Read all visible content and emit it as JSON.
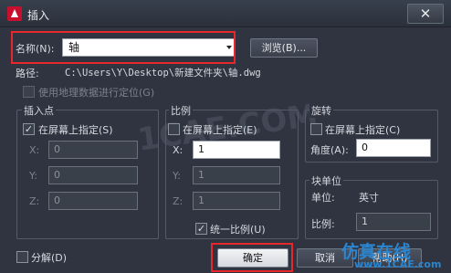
{
  "window": {
    "title": "插入",
    "close": "✕"
  },
  "name": {
    "label": "名称(N):",
    "value": "轴",
    "browse_label": "浏览(B)..."
  },
  "path": {
    "label": "路径:",
    "value": "C:\\Users\\Y\\Desktop\\新建文件夹\\轴.dwg"
  },
  "geo": {
    "label": "使用地理数据进行定位(G)"
  },
  "insertion_point": {
    "title": "插入点",
    "onscreen_label": "在屏幕上指定(S)",
    "onscreen_checked": true,
    "x_label": "X:",
    "x_value": "0",
    "y_label": "Y:",
    "y_value": "0",
    "z_label": "Z:",
    "z_value": "0"
  },
  "scale": {
    "title": "比例",
    "onscreen_label": "在屏幕上指定(E)",
    "onscreen_checked": false,
    "x_label": "X:",
    "x_value": "1",
    "y_label": "Y:",
    "y_value": "1",
    "z_label": "Z:",
    "z_value": "1",
    "uniform_label": "统一比例(U)",
    "uniform_checked": true
  },
  "rotation": {
    "title": "旋转",
    "onscreen_label": "在屏幕上指定(C)",
    "onscreen_checked": false,
    "angle_label": "角度(A):",
    "angle_value": "0"
  },
  "block_unit": {
    "title": "块单位",
    "unit_label": "单位:",
    "unit_value": "英寸",
    "factor_label": "比例:",
    "factor_value": "1"
  },
  "explode": {
    "label": "分解(D)",
    "checked": false
  },
  "buttons": {
    "ok": "确定",
    "cancel": "取消",
    "help": "帮助(H)"
  },
  "watermark": {
    "cn": "仿真在线",
    "url": "www.1CAE.com"
  },
  "colors": {
    "highlight": "#e8262c",
    "dialog_bg": "#2f3440",
    "brand": "#2a86d0"
  }
}
